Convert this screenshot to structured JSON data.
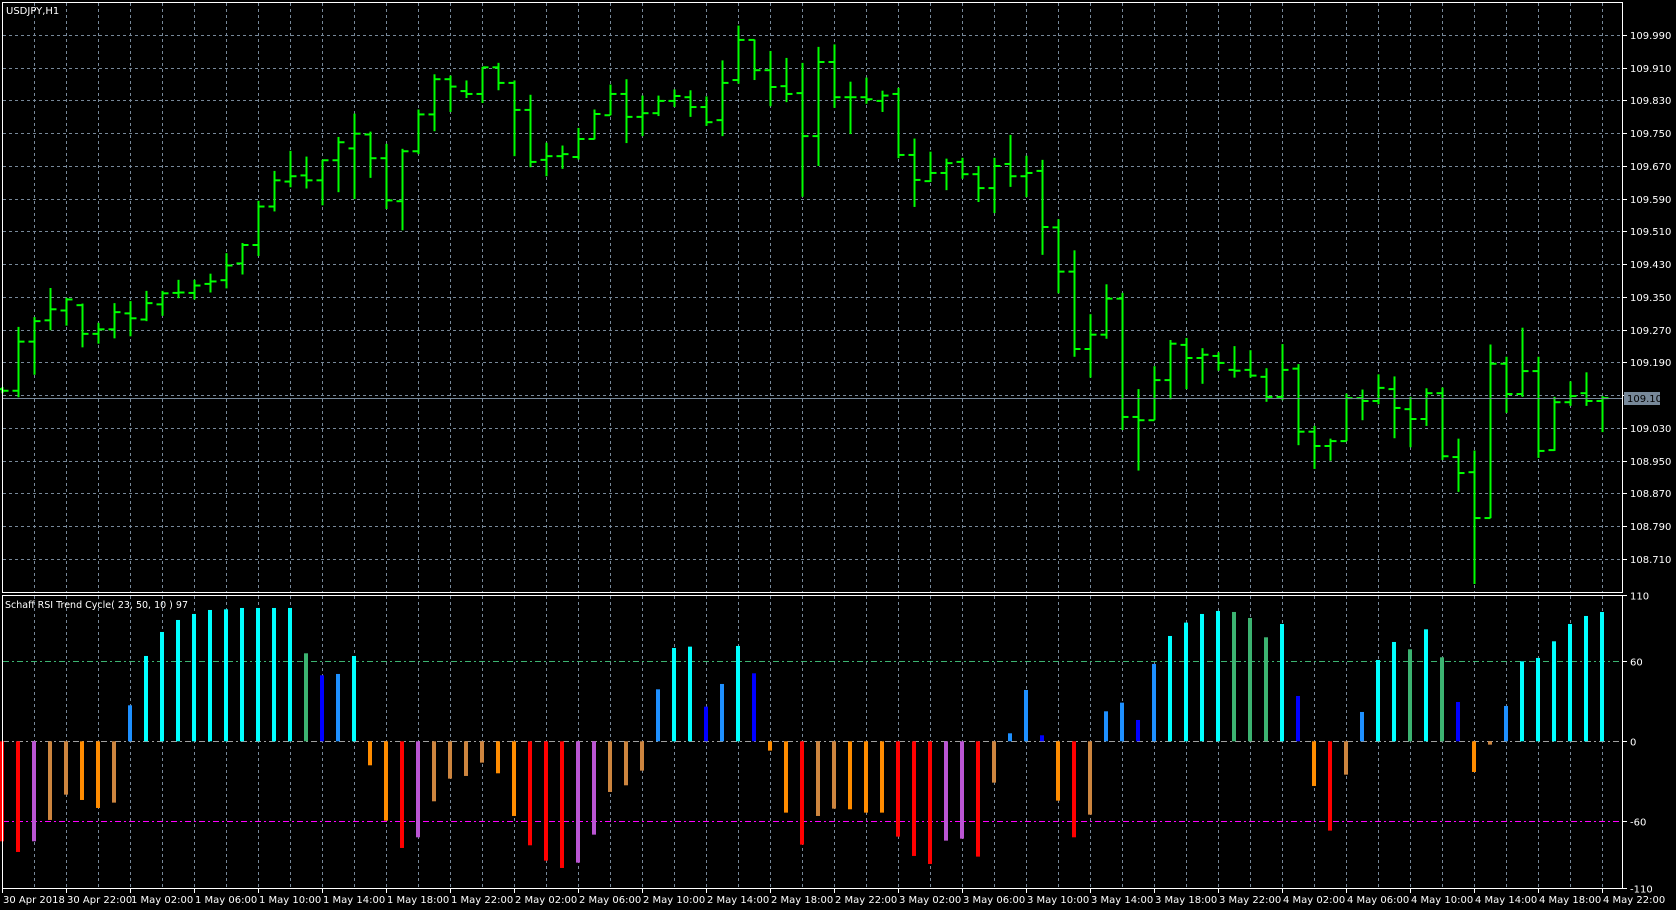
{
  "header": {
    "title": "USDJPY,H1"
  },
  "indicator": {
    "label": "Schaff RSI Trend Cycle( 23, 50, 10 ) 97"
  },
  "current_price": {
    "value": 109.102,
    "label": "109.102"
  },
  "price_axis": {
    "labels": [
      "109.990",
      "109.910",
      "109.830",
      "109.750",
      "109.670",
      "109.590",
      "109.510",
      "109.430",
      "109.350",
      "109.270",
      "109.190",
      "109.030",
      "108.950",
      "108.870",
      "108.790",
      "108.710"
    ],
    "values": [
      109.99,
      109.91,
      109.83,
      109.75,
      109.67,
      109.59,
      109.51,
      109.43,
      109.35,
      109.27,
      109.19,
      109.03,
      108.95,
      108.87,
      108.79,
      108.71
    ],
    "grid_values": [
      109.99,
      109.91,
      109.83,
      109.75,
      109.67,
      109.59,
      109.51,
      109.43,
      109.35,
      109.27,
      109.19,
      109.11,
      109.03,
      108.95,
      108.87,
      108.79,
      108.71
    ]
  },
  "indicator_axis": {
    "labels": [
      "110",
      "60",
      "0",
      "-60",
      "-110"
    ],
    "values": [
      110,
      60,
      0,
      -60,
      -110
    ]
  },
  "time_axis": {
    "labels": [
      "30 Apr 2018",
      "30 Apr 22:00",
      "1 May 02:00",
      "1 May 06:00",
      "1 May 10:00",
      "1 May 14:00",
      "1 May 18:00",
      "1 May 22:00",
      "2 May 02:00",
      "2 May 06:00",
      "2 May 10:00",
      "2 May 14:00",
      "2 May 18:00",
      "2 May 22:00",
      "3 May 02:00",
      "3 May 06:00",
      "3 May 10:00",
      "3 May 14:00",
      "3 May 18:00",
      "3 May 22:00",
      "4 May 02:00",
      "4 May 06:00",
      "4 May 10:00",
      "4 May 14:00",
      "4 May 18:00",
      "4 May 22:00"
    ]
  },
  "colors": {
    "price_bar": "#00ff00",
    "grid": "#778899",
    "level_60": "#3cb371",
    "level_0": "#a0a0a0",
    "level_minus60": "#ff00ff",
    "palette": {
      "C": "#00ffff",
      "D": "#1e90ff",
      "B": "#0000ff",
      "G": "#3cb371",
      "O": "#ff8c00",
      "P": "#cd853f",
      "R": "#ff0000",
      "M": "#ba55d3"
    }
  },
  "chart_data": [
    {
      "type": "ohlc",
      "title": "USDJPY,H1",
      "ylim": [
        108.64,
        110.02
      ],
      "ohlc": [
        [
          109.125,
          109.13,
          109.115,
          109.121
        ],
        [
          109.121,
          109.277,
          109.105,
          109.241
        ],
        [
          109.241,
          109.301,
          109.16,
          109.291
        ],
        [
          109.293,
          109.372,
          109.269,
          109.32
        ],
        [
          109.317,
          109.348,
          109.28,
          109.344
        ],
        [
          109.33,
          109.334,
          109.227,
          109.26
        ],
        [
          109.26,
          109.287,
          109.236,
          109.271
        ],
        [
          109.271,
          109.335,
          109.249,
          109.313
        ],
        [
          109.31,
          109.34,
          109.254,
          109.298
        ],
        [
          109.295,
          109.365,
          109.291,
          109.335
        ],
        [
          109.332,
          109.365,
          109.304,
          109.359
        ],
        [
          109.36,
          109.392,
          109.347,
          109.361
        ],
        [
          109.36,
          109.392,
          109.344,
          109.378
        ],
        [
          109.382,
          109.407,
          109.361,
          109.388
        ],
        [
          109.391,
          109.457,
          109.371,
          109.427
        ],
        [
          109.432,
          109.482,
          109.405,
          109.477
        ],
        [
          109.477,
          109.585,
          109.45,
          109.571
        ],
        [
          109.571,
          109.658,
          109.559,
          109.635
        ],
        [
          109.632,
          109.707,
          109.618,
          109.645
        ],
        [
          109.647,
          109.693,
          109.615,
          109.635
        ],
        [
          109.635,
          109.685,
          109.574,
          109.684
        ],
        [
          109.684,
          109.741,
          109.606,
          109.728
        ],
        [
          109.713,
          109.798,
          109.589,
          109.749
        ],
        [
          109.747,
          109.754,
          109.641,
          109.689
        ],
        [
          109.689,
          109.724,
          109.565,
          109.586
        ],
        [
          109.584,
          109.712,
          109.513,
          109.706
        ],
        [
          109.706,
          109.808,
          109.699,
          109.796
        ],
        [
          109.796,
          109.894,
          109.755,
          109.882
        ],
        [
          109.882,
          109.891,
          109.802,
          109.864
        ],
        [
          109.853,
          109.879,
          109.836,
          109.846
        ],
        [
          109.846,
          109.912,
          109.824,
          109.911
        ],
        [
          109.911,
          109.922,
          109.855,
          109.873
        ],
        [
          109.873,
          109.879,
          109.694,
          109.807
        ],
        [
          109.807,
          109.844,
          109.667,
          109.68
        ],
        [
          109.685,
          109.727,
          109.645,
          109.694
        ],
        [
          109.694,
          109.72,
          109.663,
          109.699
        ],
        [
          109.692,
          109.763,
          109.686,
          109.736
        ],
        [
          109.736,
          109.808,
          109.735,
          109.797
        ],
        [
          109.794,
          109.869,
          109.794,
          109.846
        ],
        [
          109.846,
          109.882,
          109.726,
          109.79
        ],
        [
          109.79,
          109.842,
          109.743,
          109.799
        ],
        [
          109.799,
          109.842,
          109.792,
          109.829
        ],
        [
          109.829,
          109.857,
          109.814,
          109.841
        ],
        [
          109.838,
          109.855,
          109.79,
          109.814
        ],
        [
          109.814,
          109.84,
          109.768,
          109.777
        ],
        [
          109.782,
          109.928,
          109.743,
          109.873
        ],
        [
          109.88,
          110.013,
          109.871,
          109.978
        ],
        [
          109.978,
          109.979,
          109.88,
          109.904
        ],
        [
          109.904,
          109.951,
          109.816,
          109.863
        ],
        [
          109.865,
          109.934,
          109.826,
          109.846
        ],
        [
          109.848,
          109.922,
          109.595,
          109.743
        ],
        [
          109.743,
          109.961,
          109.67,
          109.924
        ],
        [
          109.924,
          109.967,
          109.812,
          109.838
        ],
        [
          109.838,
          109.876,
          109.748,
          109.838
        ],
        [
          109.838,
          109.886,
          109.822,
          109.833
        ],
        [
          109.829,
          109.854,
          109.802,
          109.842
        ],
        [
          109.846,
          109.861,
          109.689,
          109.697
        ],
        [
          109.697,
          109.737,
          109.57,
          109.636
        ],
        [
          109.633,
          109.705,
          109.631,
          109.653
        ],
        [
          109.653,
          109.688,
          109.611,
          109.677
        ],
        [
          109.68,
          109.69,
          109.639,
          109.65
        ],
        [
          109.65,
          109.67,
          109.582,
          109.616
        ],
        [
          109.616,
          109.69,
          109.555,
          109.67
        ],
        [
          109.675,
          109.746,
          109.619,
          109.645
        ],
        [
          109.645,
          109.695,
          109.594,
          109.653
        ],
        [
          109.658,
          109.685,
          109.453,
          109.521
        ],
        [
          109.52,
          109.54,
          109.359,
          109.412
        ],
        [
          109.412,
          109.464,
          109.204,
          109.223
        ],
        [
          109.223,
          109.308,
          109.153,
          109.258
        ],
        [
          109.258,
          109.381,
          109.248,
          109.346
        ],
        [
          109.346,
          109.36,
          109.025,
          109.057
        ],
        [
          109.057,
          109.125,
          108.926,
          109.049
        ],
        [
          109.049,
          109.181,
          109.049,
          109.147
        ],
        [
          109.147,
          109.245,
          109.1,
          109.236
        ],
        [
          109.233,
          109.25,
          109.125,
          109.201
        ],
        [
          109.201,
          109.225,
          109.138,
          109.209
        ],
        [
          109.206,
          109.215,
          109.17,
          109.189
        ],
        [
          109.172,
          109.23,
          109.153,
          109.17
        ],
        [
          109.172,
          109.22,
          109.153,
          109.158
        ],
        [
          109.155,
          109.176,
          109.094,
          109.106
        ],
        [
          109.106,
          109.235,
          109.098,
          109.172
        ],
        [
          109.175,
          109.186,
          108.988,
          109.021
        ],
        [
          109.021,
          109.035,
          108.93,
          108.986
        ],
        [
          108.986,
          109.004,
          108.95,
          108.998
        ],
        [
          108.998,
          109.114,
          108.998,
          109.103
        ],
        [
          109.103,
          109.124,
          109.049,
          109.096
        ],
        [
          109.096,
          109.161,
          109.088,
          109.128
        ],
        [
          109.125,
          109.156,
          109.005,
          109.079
        ],
        [
          109.076,
          109.106,
          108.983,
          109.052
        ],
        [
          109.052,
          109.127,
          109.035,
          109.115
        ],
        [
          109.115,
          109.129,
          108.952,
          108.961
        ],
        [
          108.959,
          109.004,
          108.874,
          108.92
        ],
        [
          108.922,
          108.975,
          108.649,
          108.81
        ],
        [
          108.81,
          109.234,
          108.81,
          109.187
        ],
        [
          109.187,
          109.204,
          109.067,
          109.113
        ],
        [
          109.113,
          109.275,
          109.106,
          109.169
        ],
        [
          109.169,
          109.204,
          108.957,
          108.974
        ],
        [
          108.976,
          109.106,
          108.974,
          109.093
        ],
        [
          109.093,
          109.144,
          109.084,
          109.108
        ],
        [
          109.115,
          109.166,
          109.084,
          109.096
        ],
        [
          109.096,
          109.108,
          109.02,
          109.103
        ]
      ]
    },
    {
      "type": "bar",
      "title": "Schaff RSI Trend Cycle( 23, 50, 10 ) 97",
      "ylim": [
        -110,
        110
      ],
      "levels": [
        60,
        0,
        -60
      ],
      "values": [
        -75,
        -83,
        -75,
        -59,
        -40,
        -44,
        -50,
        -46,
        27,
        64,
        82,
        91,
        95.5,
        98.5,
        99,
        100,
        100,
        100,
        100,
        66,
        49.5,
        50.5,
        64,
        -18,
        -59.5,
        -80,
        -72,
        -45,
        -28,
        -26,
        -16,
        -24,
        -56,
        -78,
        -89.5,
        -95,
        -91,
        -70,
        -38,
        -33,
        -22,
        39,
        70,
        71,
        26,
        43,
        71.5,
        51,
        -7,
        -53.5,
        -77.5,
        -56,
        -50.5,
        -51,
        -53.5,
        -53.5,
        -71.5,
        -86,
        -92,
        -74.5,
        -73,
        -86.5,
        -31,
        6,
        38.5,
        4.5,
        -44.5,
        -72,
        -55,
        22.5,
        29,
        16,
        58,
        79,
        89,
        95.5,
        97.75,
        97,
        92.5,
        78,
        88,
        34,
        -33.5,
        -67,
        -25,
        22,
        61,
        74.5,
        69,
        84,
        63,
        29.5,
        -23,
        -2.5,
        26.5,
        60,
        62.5,
        75,
        88,
        94,
        97
      ],
      "color_codes": "RRMPPOOPDCCCCCCCCCCGBDCOORMPPPPOORRRMMPPPDCCBDCBOORPPOOORRRMMRPDDBORPDDBDCCCCGGGCBORPDCCGCGBOPDCCCCCC"
    }
  ]
}
